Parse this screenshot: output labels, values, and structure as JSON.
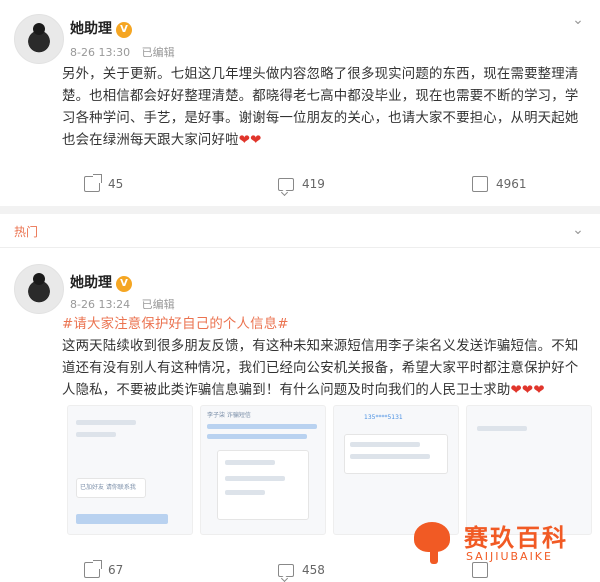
{
  "post1": {
    "author": "她助理",
    "badge": "V",
    "time": "8-26 13:30",
    "status": "已编辑",
    "content_lines": [
      "另外，关于更新。七姐这几年埋头做内容忽略了很多现实问题的东西，现在需要整理清",
      "楚。也相信都会好好整理清楚。都晓得老七高中都没毕业，现在也需要不断的学习，学",
      "习各种学问、手艺，是好事。谢谢每一位朋友的关心，也请大家不要担心，从明天起她",
      "也会在绿洲每天跟大家问好啦"
    ],
    "hearts": "❤❤",
    "shares": "45",
    "comments": "419",
    "likes": "4961"
  },
  "hot_label": "热门",
  "post2": {
    "author": "她助理",
    "badge": "V",
    "time": "8-26 13:24",
    "status": "已编辑",
    "hashtag": "#请大家注意保护好自己的个人信息#",
    "content_lines": [
      "这两天陆续收到很多朋友反馈，有这种未知来源短信用李子柒名义发送诈骗短信。不知",
      "道还有没有别人有这种情况，我们已经向公安机关报备，希望大家平时都注意保护好个",
      "人隐私，不要被此类诈骗信息骗到！有什么问题及时向我们的人民卫士求助"
    ],
    "hearts": "❤❤❤",
    "images": [
      {
        "snippet": "已加好友 请你联系我"
      },
      {
        "snippet": "李子柒 诈骗短信"
      },
      {
        "snippet": "135****5131"
      },
      {
        "snippet": ""
      }
    ],
    "shares": "67",
    "comments": "458",
    "likes": ""
  },
  "watermark": {
    "title": "赛玖百科",
    "subtitle": "SAIJIUBAIKE"
  },
  "colors": {
    "accent": "#eb7350",
    "heart": "#e0352b",
    "watermark": "#f15a24"
  }
}
